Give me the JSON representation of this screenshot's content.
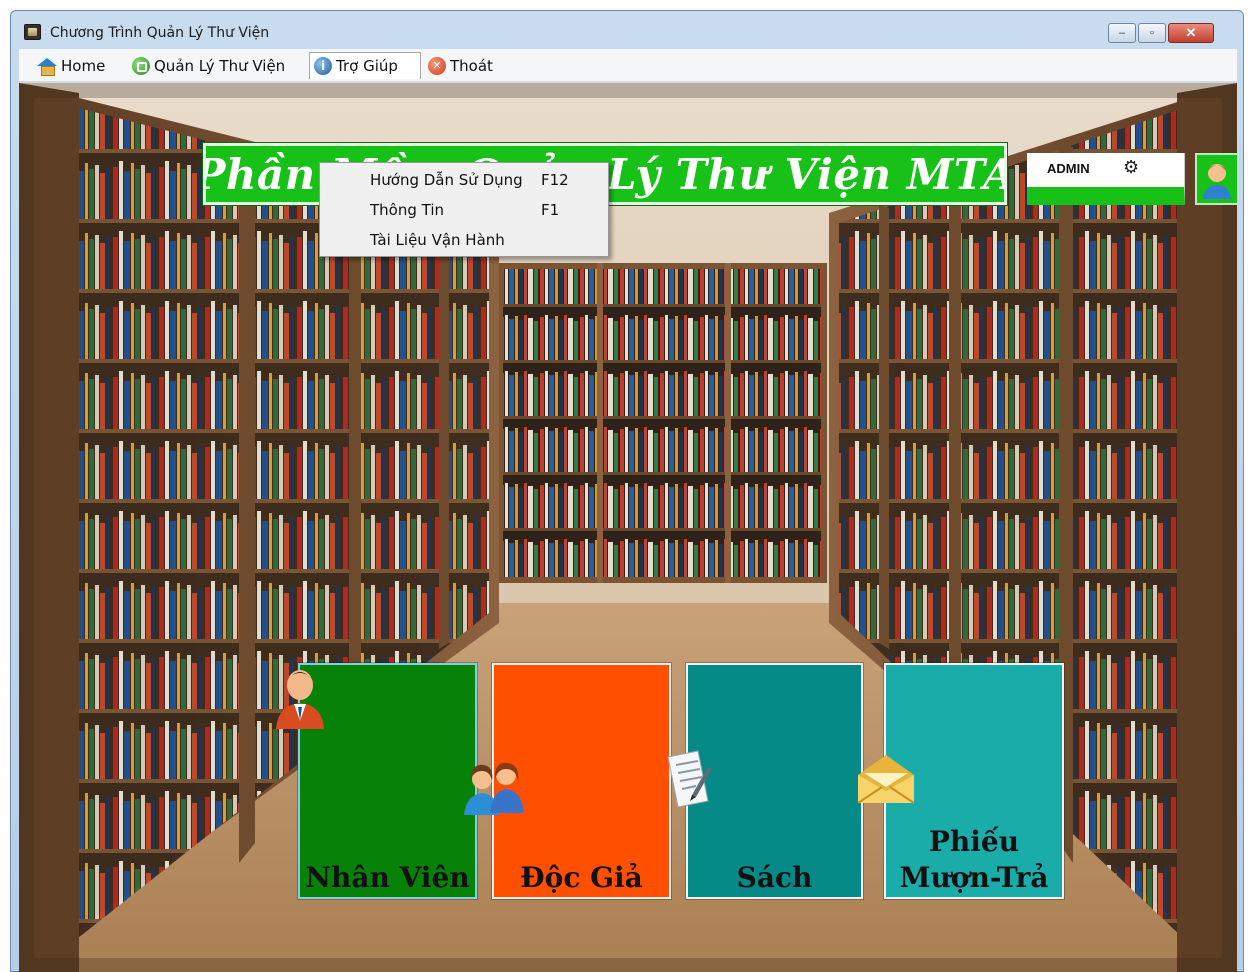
{
  "window": {
    "title": "Chương Trình Quản Lý Thư Viện",
    "controls": {
      "minimize": "–",
      "maximize": "▫",
      "close": "✕"
    }
  },
  "menubar": {
    "items": [
      {
        "label": "Home",
        "icon": "home-icon"
      },
      {
        "label": "Quản Lý Thư Viện",
        "icon": "library-icon"
      },
      {
        "label": "Trợ Giúp",
        "icon": "info-icon",
        "open": true
      },
      {
        "label": "Thoát",
        "icon": "exit-icon"
      }
    ]
  },
  "help_menu": {
    "items": [
      {
        "label": "Hướng Dẫn Sử Dụng",
        "shortcut": "F12"
      },
      {
        "label": "Thông Tin",
        "shortcut": "F1"
      },
      {
        "label": "Tài Liệu Vận Hành",
        "shortcut": ""
      }
    ]
  },
  "banner": {
    "title": "Phần Mềm Quản Lý Thư Viện MTA",
    "color": "#17c117"
  },
  "user": {
    "name": "ADMIN",
    "settings_icon": "gear-icon",
    "avatar_icon": "user-avatar-icon"
  },
  "tiles": [
    {
      "label_line1": "Nhân Viên",
      "label_line2": "",
      "icon": "employee-icon",
      "color": "#078107"
    },
    {
      "label_line1": "Độc Giả",
      "label_line2": "",
      "icon": "readers-icon",
      "color": "#ff4f00"
    },
    {
      "label_line1": "Sách",
      "label_line2": "",
      "icon": "document-icon",
      "color": "#058a87"
    },
    {
      "label_line1": "Phiếu",
      "label_line2": "Mượn-Trả",
      "icon": "envelope-icon",
      "color": "#1aaca9"
    }
  ]
}
